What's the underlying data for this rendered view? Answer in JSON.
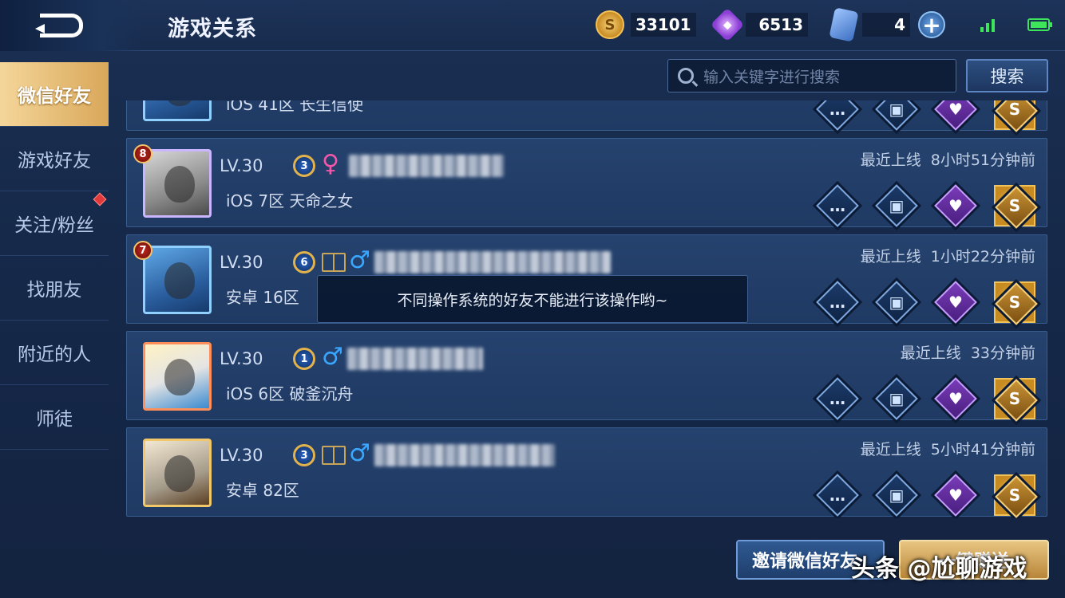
{
  "header": {
    "title": "游戏关系",
    "gold": "33101",
    "diamonds": "6513",
    "tickets": "4"
  },
  "sidebar": {
    "items": [
      {
        "label": "微信好友",
        "active": true
      },
      {
        "label": "游戏好友"
      },
      {
        "label": "关注/粉丝",
        "badge": true
      },
      {
        "label": "找朋友"
      },
      {
        "label": "附近的人"
      },
      {
        "label": "师徒"
      }
    ]
  },
  "search": {
    "placeholder": "输入关键字进行搜索",
    "button_label": "搜索"
  },
  "friends": [
    {
      "level": "",
      "vip": "",
      "gender": "",
      "server": "iOS 41区 长生信使",
      "last_label": "",
      "last_time": "",
      "rank": ""
    },
    {
      "level": "LV.30",
      "vip": "3",
      "gender": "♀",
      "server": "iOS 7区 天命之女",
      "last_label": "最近上线",
      "last_time": "8小时51分钟前",
      "rank": "8"
    },
    {
      "level": "LV.30",
      "vip": "6",
      "gender": "♂",
      "server": "安卓 16区",
      "last_label": "最近上线",
      "last_time": "1小时22分钟前",
      "rank": "7"
    },
    {
      "level": "LV.30",
      "vip": "1",
      "gender": "♂",
      "server": "iOS 6区 破釜沉舟",
      "last_label": "最近上线",
      "last_time": "33分钟前",
      "rank": ""
    },
    {
      "level": "LV.30",
      "vip": "3",
      "gender": "♂",
      "server": "安卓 82区",
      "last_label": "最近上线",
      "last_time": "5小时41分钟前",
      "rank": ""
    }
  ],
  "toast": {
    "message": "不同操作系统的好友不能进行该操作哟~"
  },
  "footer": {
    "invite_label": "邀请微信好友",
    "gold_label": "一键赠送",
    "watermark": "头条 @尬聊游戏"
  }
}
